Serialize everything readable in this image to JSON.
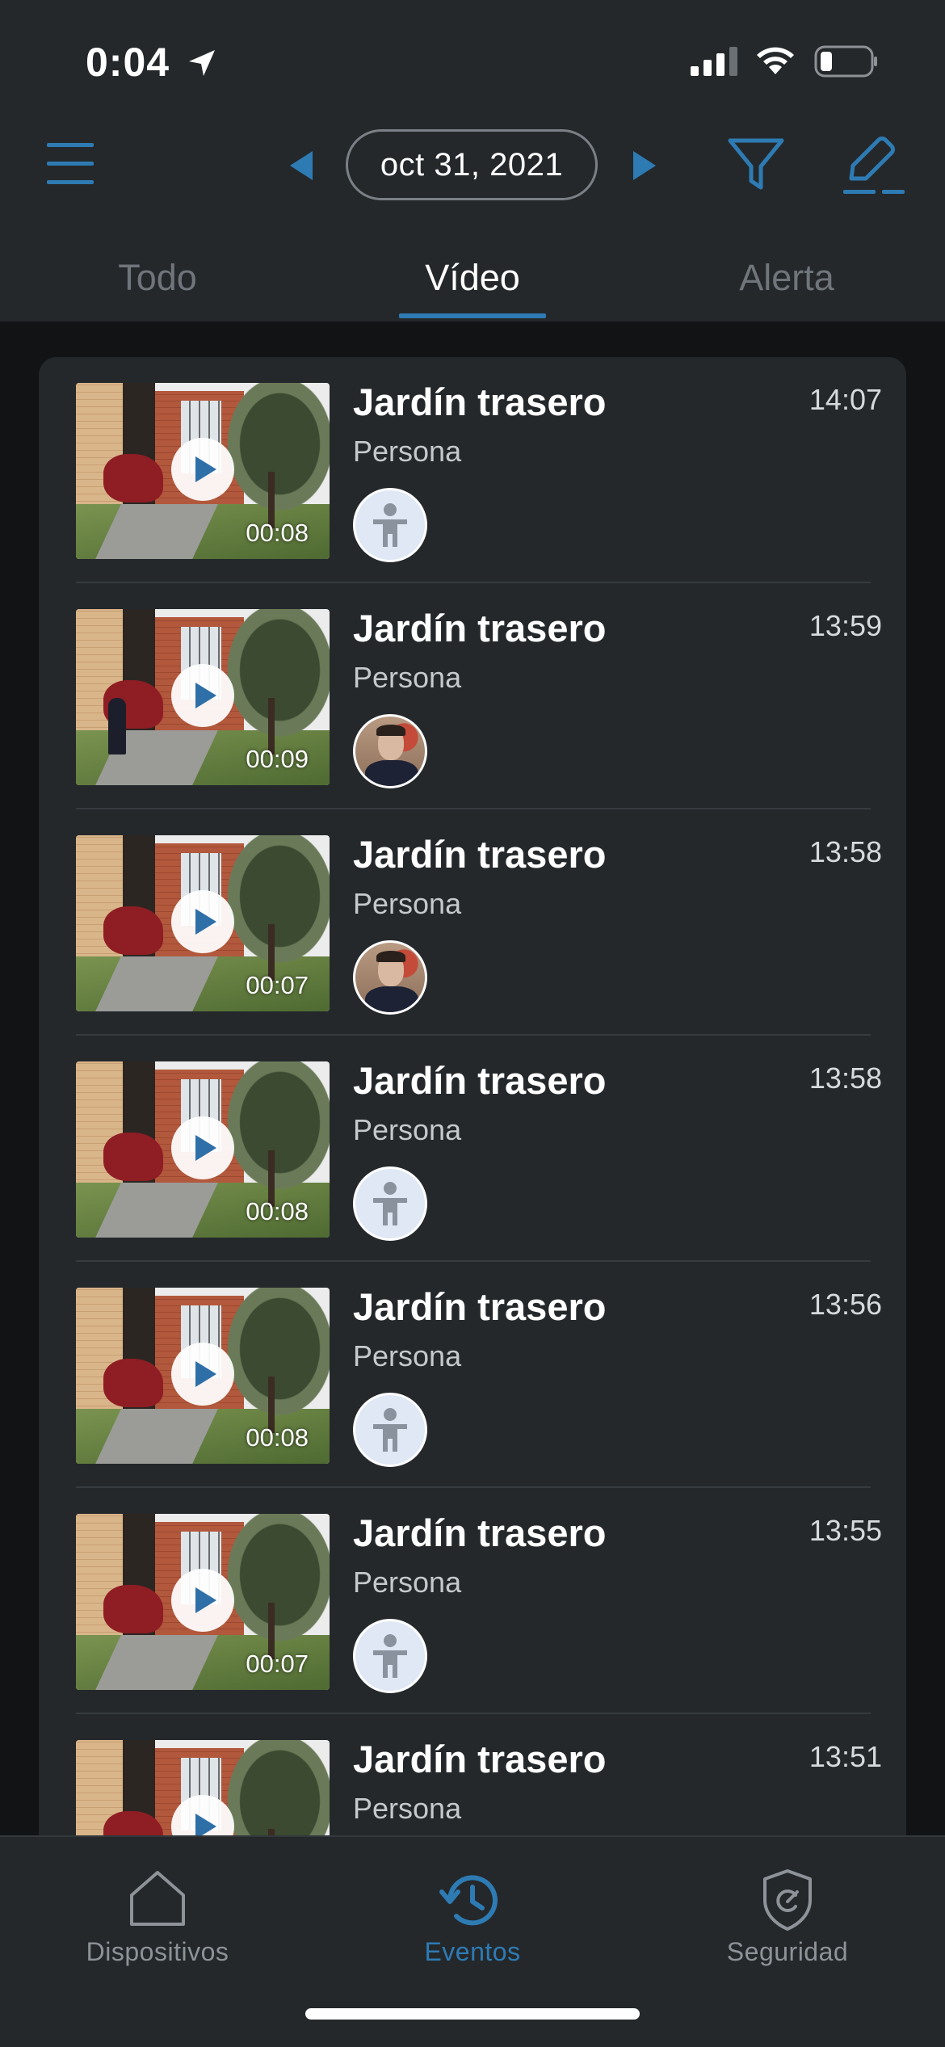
{
  "status_bar": {
    "time": "0:04"
  },
  "header": {
    "date": "oct 31, 2021",
    "tabs": [
      {
        "label": "Todo",
        "active": false
      },
      {
        "label": "Vídeo",
        "active": true
      },
      {
        "label": "Alerta",
        "active": false
      }
    ]
  },
  "events": [
    {
      "title": "Jardín trasero",
      "type": "Persona",
      "time": "14:07",
      "duration": "00:08",
      "avatar": "person-icon"
    },
    {
      "title": "Jardín trasero",
      "type": "Persona",
      "time": "13:59",
      "duration": "00:09",
      "avatar": "face-photo"
    },
    {
      "title": "Jardín trasero",
      "type": "Persona",
      "time": "13:58",
      "duration": "00:07",
      "avatar": "face-photo"
    },
    {
      "title": "Jardín trasero",
      "type": "Persona",
      "time": "13:58",
      "duration": "00:08",
      "avatar": "person-icon"
    },
    {
      "title": "Jardín trasero",
      "type": "Persona",
      "time": "13:56",
      "duration": "00:08",
      "avatar": "person-icon"
    },
    {
      "title": "Jardín trasero",
      "type": "Persona",
      "time": "13:55",
      "duration": "00:07",
      "avatar": "person-icon"
    },
    {
      "title": "Jardín trasero",
      "type": "Persona",
      "time": "13:51",
      "duration": "",
      "avatar": ""
    }
  ],
  "bottom_nav": [
    {
      "label": "Dispositivos",
      "icon": "house-icon",
      "active": false
    },
    {
      "label": "Eventos",
      "icon": "history-clock-icon",
      "active": true
    },
    {
      "label": "Seguridad",
      "icon": "shield-icon",
      "active": false
    }
  ],
  "colors": {
    "accent": "#2e7bb4",
    "background": "#24282b",
    "inactive": "#6f757b"
  }
}
